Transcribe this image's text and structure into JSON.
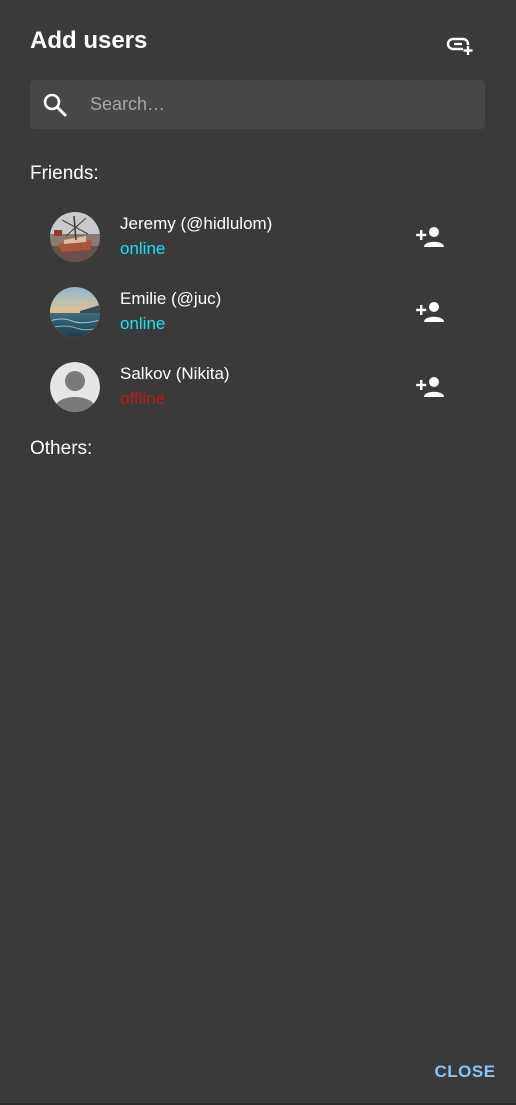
{
  "dialog": {
    "title": "Add users",
    "link_icon": "add-link-icon",
    "close_label": "CLOSE",
    "accent_color": "#90c2f0"
  },
  "search": {
    "placeholder": "Search…",
    "value": "",
    "icon": "search-icon"
  },
  "friends": {
    "label": "Friends:",
    "users": [
      {
        "name": "Jeremy (@hidlulom)",
        "status": "online",
        "avatar": "boat-photo-avatar"
      },
      {
        "name": "Emilie (@juc)",
        "status": "online",
        "avatar": "sunset-sea-photo-avatar"
      },
      {
        "name": "Salkov (Nikita)",
        "status": "offline",
        "avatar": "default-user-avatar"
      }
    ]
  },
  "others": {
    "label": "Others:"
  },
  "colors": {
    "background": "#3a3a3a",
    "online": "#19e4f0",
    "offline": "#b71c1c"
  }
}
